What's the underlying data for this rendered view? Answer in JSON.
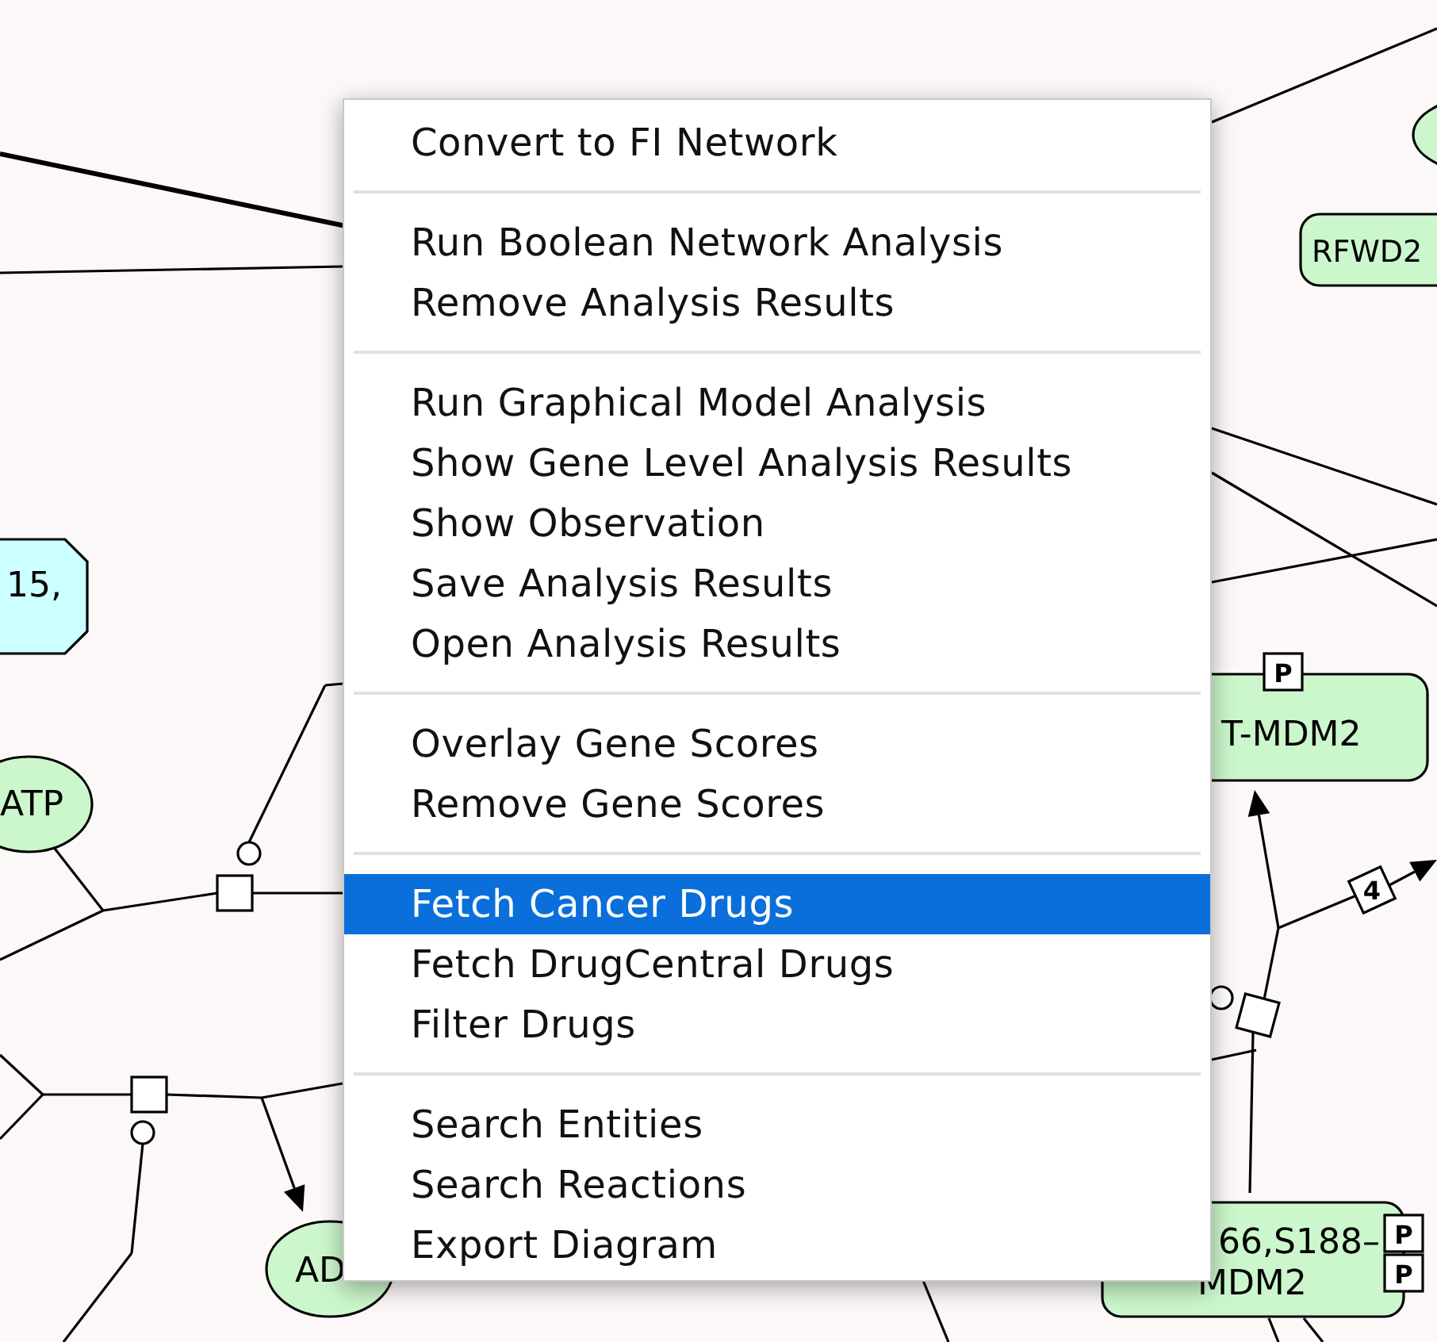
{
  "diagram": {
    "entities": [
      {
        "kind": "complex",
        "lines": [
          "15,"
        ]
      },
      {
        "kind": "molecule",
        "lines": [
          "ATP"
        ]
      },
      {
        "kind": "molecule",
        "lines": [
          "AD"
        ]
      },
      {
        "kind": "protein",
        "lines": [
          "RFWD2"
        ]
      },
      {
        "kind": "protein",
        "lines": [
          "T-MDM2"
        ],
        "badges": [
          "P"
        ]
      },
      {
        "kind": "protein",
        "lines": [
          "66,S188–",
          "MDM2"
        ],
        "badges": [
          "P",
          "P"
        ]
      }
    ],
    "stoichiometry": [
      "4"
    ]
  },
  "context_menu": {
    "sections": [
      [
        {
          "label": "Convert to FI Network",
          "selected": false
        }
      ],
      [
        {
          "label": "Run Boolean Network Analysis",
          "selected": false
        },
        {
          "label": "Remove Analysis Results",
          "selected": false
        }
      ],
      [
        {
          "label": "Run Graphical Model Analysis",
          "selected": false
        },
        {
          "label": "Show Gene Level Analysis Results",
          "selected": false
        },
        {
          "label": "Show Observation",
          "selected": false
        },
        {
          "label": "Save Analysis Results",
          "selected": false
        },
        {
          "label": "Open Analysis Results",
          "selected": false
        }
      ],
      [
        {
          "label": "Overlay Gene Scores",
          "selected": false
        },
        {
          "label": "Remove Gene Scores",
          "selected": false
        }
      ],
      [
        {
          "label": "Fetch Cancer Drugs",
          "selected": true
        },
        {
          "label": "Fetch DrugCentral Drugs",
          "selected": false
        },
        {
          "label": "Filter Drugs",
          "selected": false
        }
      ],
      [
        {
          "label": "Search Entities",
          "selected": false
        },
        {
          "label": "Search Reactions",
          "selected": false
        },
        {
          "label": "Export Diagram",
          "selected": false
        }
      ]
    ]
  }
}
